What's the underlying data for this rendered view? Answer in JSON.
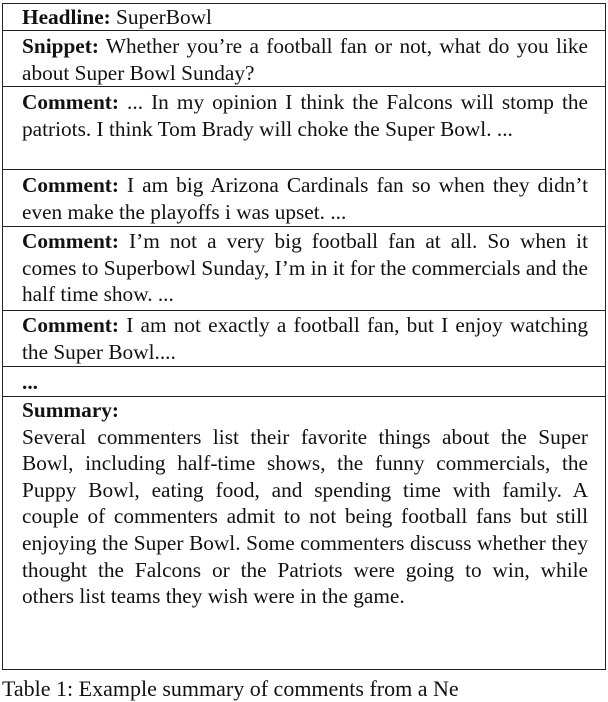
{
  "table": {
    "headline": {
      "label": "Headline:",
      "text": " SuperBowl"
    },
    "snippet": {
      "label": "Snippet:",
      "text": " Whether you’re a football fan or not, what do you like about Super Bowl Sunday?"
    },
    "comments": [
      {
        "label": "Comment:",
        "text": " ... In my opinion I think the Falcons will stomp the patriots. I think Tom Brady will choke the Super Bowl. ..."
      },
      {
        "label": "Comment:",
        "text": " I am big Arizona Cardinals fan so when they didn’t even make the playoffs i was upset. ..."
      },
      {
        "label": "Comment:",
        "text": " I’m not a very big football fan at all. So when it comes to Superbowl Sunday, I’m in it for the commercials and the half time show. ..."
      },
      {
        "label": "Comment:",
        "text": " I am not exactly a football fan, but I enjoy watching the Super Bowl...."
      }
    ],
    "ellipsis": "...",
    "summary": {
      "label": "Summary:",
      "text": "Several commenters list their favorite things about the Super Bowl, including half-time shows, the funny commercials, the Puppy Bowl, eating food, and spending time with family. A couple of commenters admit to not being football fans but still enjoying the Super Bowl. Some commenters discuss whether they thought the Falcons or the Patriots were going to win, while others list teams they wish were in the game."
    }
  },
  "caption": "Table 1: Example summary of comments from a Ne"
}
